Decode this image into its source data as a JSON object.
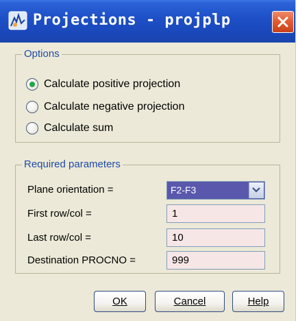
{
  "window": {
    "title": "Projections - projplp"
  },
  "options": {
    "legend": "Options",
    "radios": [
      {
        "label": "Calculate positive projection",
        "checked": true
      },
      {
        "label": "Calculate negative projection",
        "checked": false
      },
      {
        "label": "Calculate sum",
        "checked": false
      }
    ]
  },
  "params": {
    "legend": "Required parameters",
    "plane_orientation_label": "Plane orientation =",
    "plane_orientation_value": "F2-F3",
    "first_label": "First row/col =",
    "first_value": "1",
    "last_label": "Last row/col =",
    "last_value": "10",
    "dest_label": "Destination PROCNO =",
    "dest_value": "999"
  },
  "buttons": {
    "ok": "OK",
    "cancel": "Cancel",
    "help": "Help"
  },
  "colors": {
    "titlebar": "#1d4fc6",
    "legend_text": "#1e4aa8",
    "field_bg": "#f6e6e6",
    "select_bg": "#5a58ad",
    "radio_dot": "#23a54a"
  },
  "icons": {
    "app": "bruker-app-icon",
    "close": "close-icon",
    "dropdown": "chevron-down-icon"
  }
}
